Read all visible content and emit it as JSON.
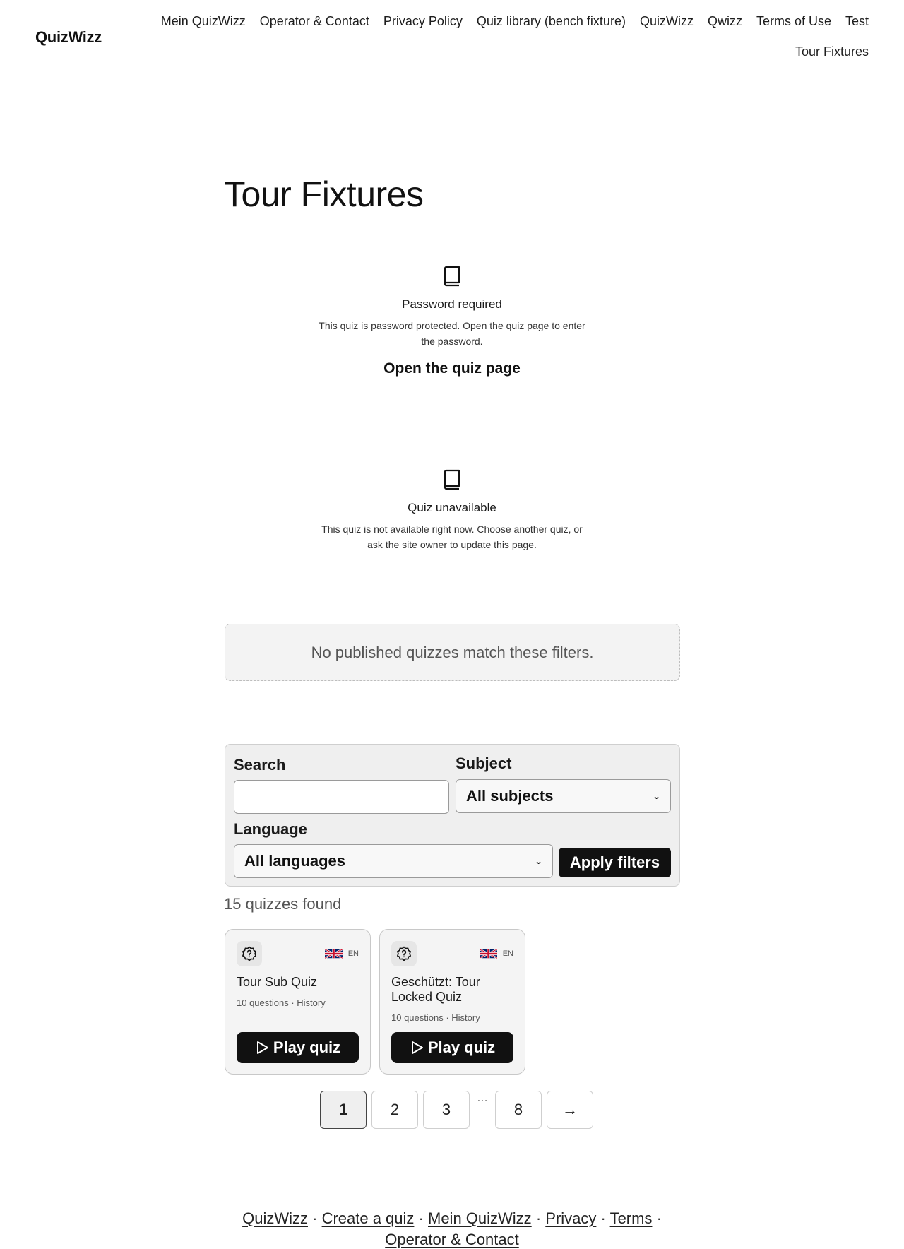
{
  "header": {
    "site_title": "QuizWizz",
    "nav": [
      "Mein QuizWizz",
      "Operator & Contact",
      "Privacy Policy",
      "Quiz library (bench fixture)",
      "QuizWizz",
      "Qwizz",
      "Terms of Use",
      "Test",
      "Tour Fixtures"
    ]
  },
  "page": {
    "title": "Tour Fixtures"
  },
  "notices": [
    {
      "icon": "book-icon",
      "title": "Password required",
      "text": "This quiz is password protected. Open the quiz page to enter the password.",
      "link": "Open the quiz page"
    },
    {
      "icon": "book-icon",
      "title": "Quiz unavailable",
      "text": "This quiz is not available right now. Choose another quiz, or ask the site owner to update this page."
    }
  ],
  "empty_message": "No published quizzes match these filters.",
  "filters": {
    "search_label": "Search",
    "search_value": "",
    "subject_label": "Subject",
    "subject_value": "All subjects",
    "language_label": "Language",
    "language_value": "All languages",
    "apply_label": "Apply filters"
  },
  "results_count": "15 quizzes found",
  "cards": [
    {
      "title": "Tour Sub Quiz",
      "meta": "10 questions · History",
      "lang": "EN",
      "play_label": "Play quiz"
    },
    {
      "title": "Geschützt: Tour Locked Quiz",
      "meta": "10 questions · History",
      "lang": "EN",
      "play_label": "Play quiz"
    }
  ],
  "pagination": {
    "pages": [
      "1",
      "2",
      "3"
    ],
    "ellipsis": "…",
    "last": "8",
    "next": "→",
    "current": "1"
  },
  "footer": {
    "links": [
      "QuizWizz",
      "Create a quiz",
      "Mein QuizWizz",
      "Privacy",
      "Terms",
      "Operator & Contact"
    ],
    "separator": "·"
  },
  "colors": {
    "text": "#111111",
    "button": "#111111",
    "panel": "#efefef",
    "card": "#f4f4f4"
  }
}
